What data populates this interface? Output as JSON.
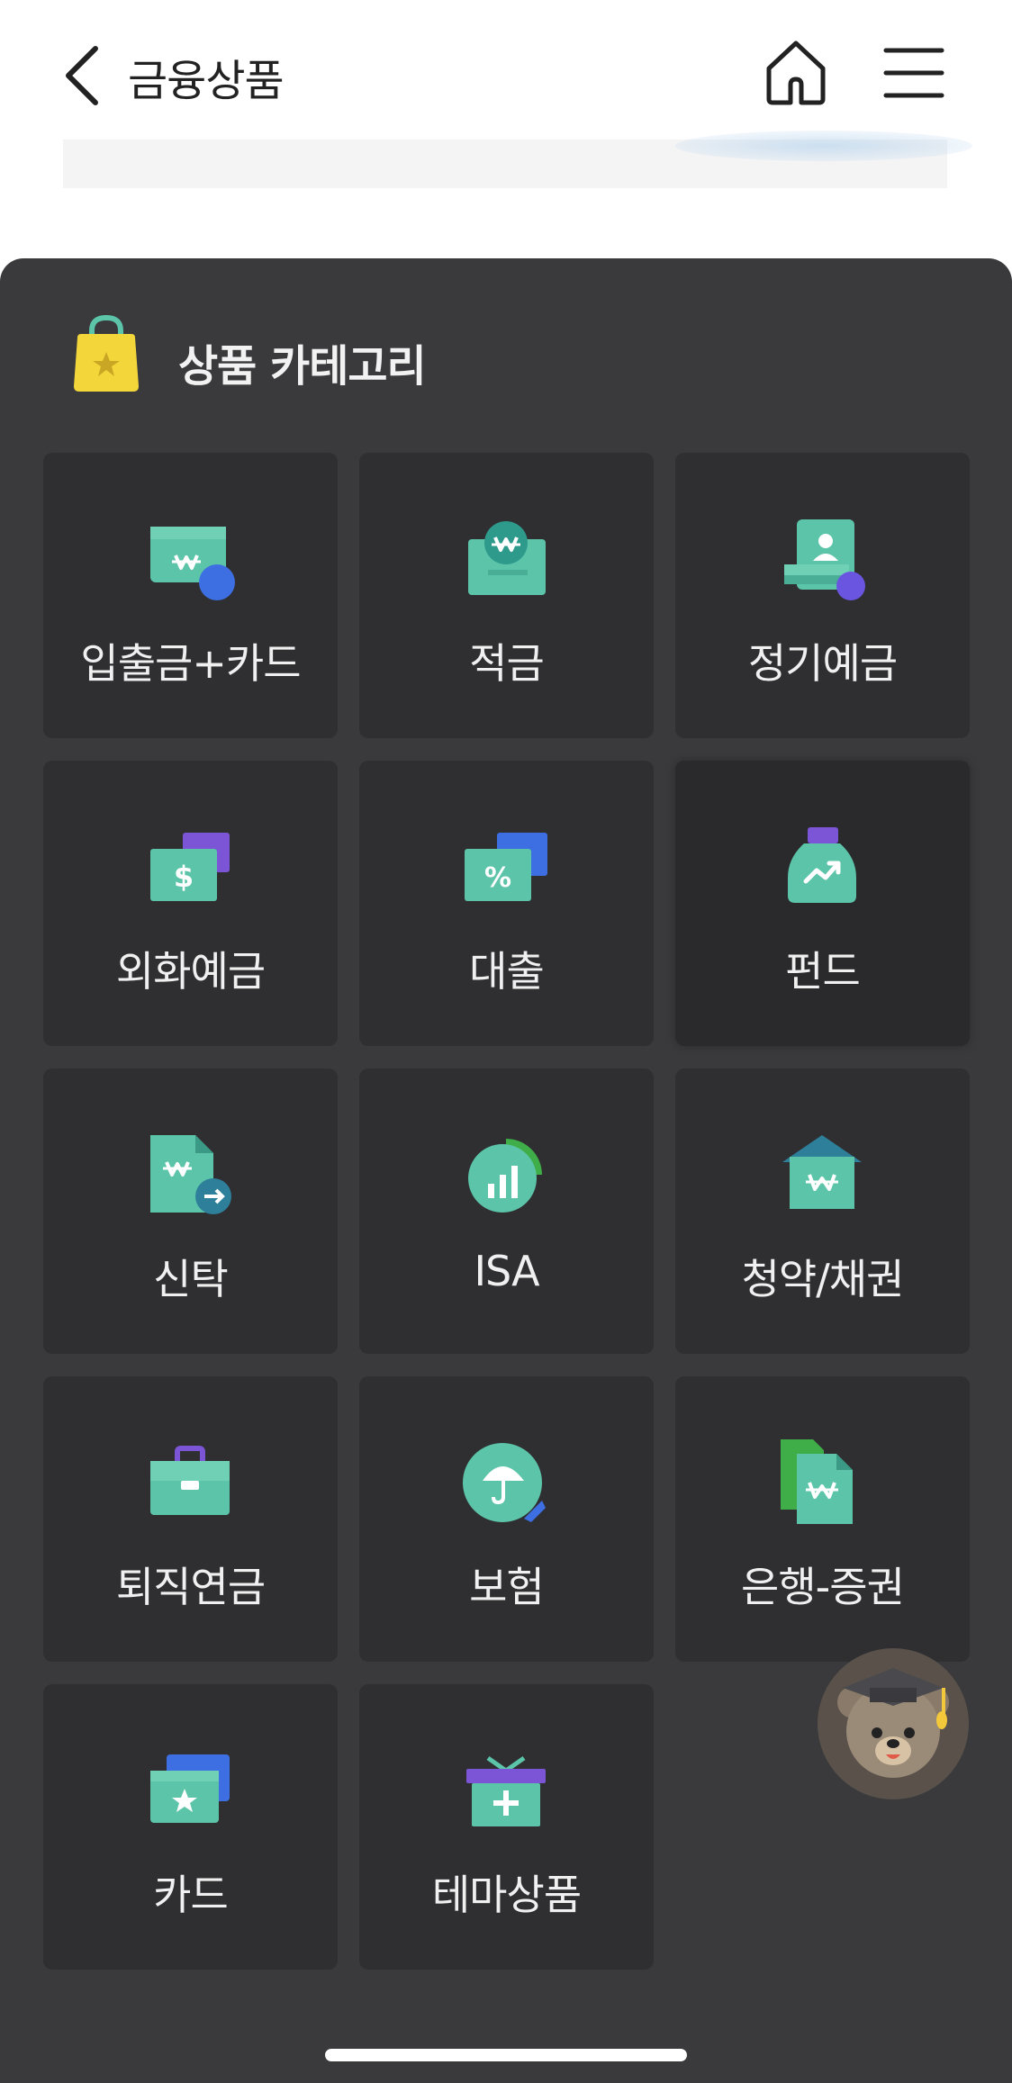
{
  "header": {
    "title": "금융상품",
    "back_icon": "chevron-left-icon",
    "home_icon": "home-icon",
    "menu_icon": "hamburger-menu-icon"
  },
  "category": {
    "title": "상품 카테고리",
    "icon": "shopping-bag-star-icon"
  },
  "tiles": [
    {
      "label": "입출금+카드",
      "icon": "wallet-won-card-icon"
    },
    {
      "label": "적금",
      "icon": "savings-box-won-icon"
    },
    {
      "label": "정기예금",
      "icon": "deposit-person-icon"
    },
    {
      "label": "외화예금",
      "icon": "foreign-currency-dollar-icon"
    },
    {
      "label": "대출",
      "icon": "loan-percent-icon"
    },
    {
      "label": "펀드",
      "icon": "fund-jar-chart-icon"
    },
    {
      "label": "신탁",
      "icon": "trust-document-arrow-icon"
    },
    {
      "label": "ISA",
      "icon": "isa-bar-chart-icon"
    },
    {
      "label": "청약/채권",
      "icon": "subscription-house-won-icon"
    },
    {
      "label": "퇴직연금",
      "icon": "pension-briefcase-icon"
    },
    {
      "label": "보험",
      "icon": "insurance-umbrella-icon"
    },
    {
      "label": "은행-증권",
      "icon": "bank-securities-docs-icon"
    },
    {
      "label": "카드",
      "icon": "card-star-icon"
    },
    {
      "label": "테마상품",
      "icon": "theme-gift-box-icon"
    }
  ],
  "chatbot": {
    "icon": "bear-mascot-graduate-icon"
  },
  "colors": {
    "panel_bg": "#3a3a3d",
    "tile_bg": "#2f2f32",
    "icon_teal": "#5cc4a9",
    "icon_blue": "#3d6fe3",
    "icon_purple": "#7b55d6",
    "bag_yellow": "#f3d73a"
  }
}
